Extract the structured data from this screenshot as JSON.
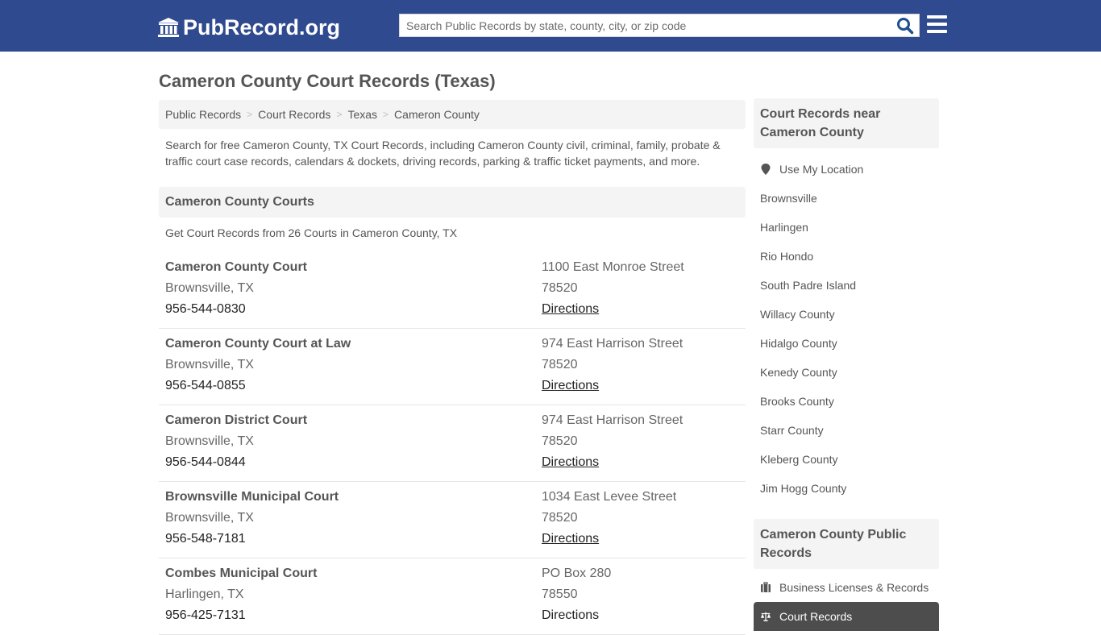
{
  "header": {
    "logo_text": "PubRecord.org",
    "search_placeholder": "Search Public Records by state, county, city, or zip code",
    "brand_color": "#2f4a8f"
  },
  "page": {
    "title": "Cameron County Court Records (Texas)"
  },
  "breadcrumb": [
    "Public Records",
    "Court Records",
    "Texas",
    "Cameron County"
  ],
  "intro": "Search for free Cameron County, TX Court Records, including Cameron County civil, criminal, family, probate & traffic court case records, calendars & dockets, driving records, parking & traffic ticket payments, and more.",
  "courts_section": {
    "heading": "Cameron County Courts",
    "subtitle": "Get Court Records from 26 Courts in Cameron County, TX",
    "items": [
      {
        "name": "Cameron County Court",
        "city": "Brownsville, TX",
        "phone": "956-544-0830",
        "address": "1100 East Monroe Street",
        "zip": "78520",
        "directions": "Directions"
      },
      {
        "name": "Cameron County Court at Law",
        "city": "Brownsville, TX",
        "phone": "956-544-0855",
        "address": "974 East Harrison Street",
        "zip": "78520",
        "directions": "Directions"
      },
      {
        "name": "Cameron District Court",
        "city": "Brownsville, TX",
        "phone": "956-544-0844",
        "address": "974 East Harrison Street",
        "zip": "78520",
        "directions": "Directions"
      },
      {
        "name": "Brownsville Municipal Court",
        "city": "Brownsville, TX",
        "phone": "956-548-7181",
        "address": "1034 East Levee Street",
        "zip": "78520",
        "directions": "Directions"
      },
      {
        "name": "Combes Municipal Court",
        "city": "Harlingen, TX",
        "phone": "956-425-7131",
        "address": "PO Box 280",
        "zip": "78550",
        "directions": "Directions"
      }
    ]
  },
  "sidebar": {
    "nearby": {
      "heading": "Court Records near Cameron County",
      "use_location": "Use My Location",
      "items": [
        "Brownsville",
        "Harlingen",
        "Rio Hondo",
        "South Padre Island",
        "Willacy County",
        "Hidalgo County",
        "Kenedy County",
        "Brooks County",
        "Starr County",
        "Kleberg County",
        "Jim Hogg County"
      ]
    },
    "public_records": {
      "heading": "Cameron County Public Records",
      "items": [
        {
          "label": "Business Licenses & Records",
          "icon": "briefcase-icon",
          "active": false
        },
        {
          "label": "Court Records",
          "icon": "scales-icon",
          "active": true
        }
      ]
    }
  }
}
